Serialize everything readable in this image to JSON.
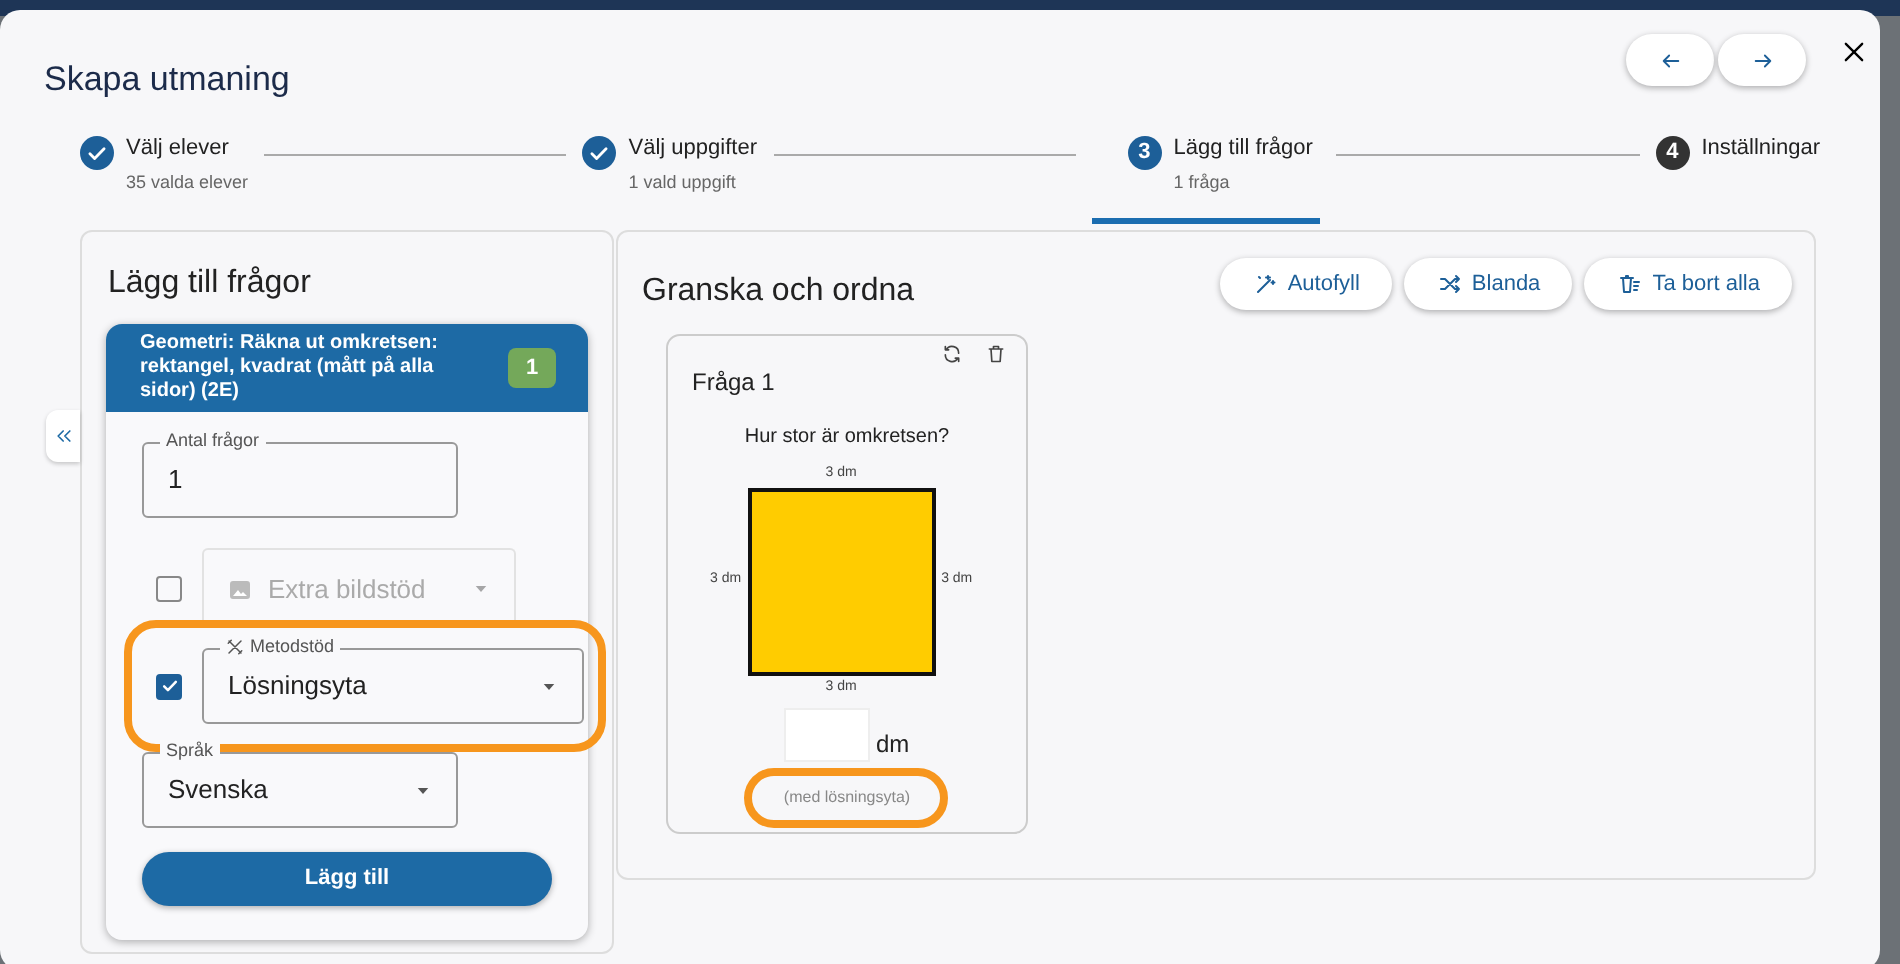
{
  "dialog": {
    "title": "Skapa utmaning"
  },
  "steps": [
    {
      "label": "Välj elever",
      "sublabel": "35 valda elever",
      "completed": true,
      "selected": false
    },
    {
      "label": "Välj uppgifter",
      "sublabel": "1 vald uppgift",
      "completed": true,
      "selected": false
    },
    {
      "label": "Lägg till frågor",
      "sublabel": "1 fråga",
      "number": "3",
      "completed": false,
      "selected": true
    },
    {
      "label": "Inställningar",
      "number": "4",
      "completed": false,
      "selected": false
    }
  ],
  "add_panel": {
    "title": "Lägg till frågor",
    "task": {
      "title": "Geometri: Räkna ut omkretsen: rektangel, kvadrat (mått på alla sidor) (2E)",
      "count": "1"
    },
    "count_field": {
      "label": "Antal frågor",
      "value": "1"
    },
    "options": [
      {
        "kind": "image-support",
        "value": "Extra bildstöd",
        "checked": false,
        "disabled": true,
        "highlighted": false
      },
      {
        "kind": "method-support",
        "label": "Metodstöd",
        "value": "Lösningsyta",
        "checked": true,
        "disabled": false,
        "highlighted": true
      }
    ],
    "language": {
      "label": "Språk",
      "value": "Svenska"
    },
    "add_button": "Lägg till"
  },
  "review_panel": {
    "title": "Granska och ordna",
    "actions": [
      {
        "kind": "autofill",
        "label": "Autofyll"
      },
      {
        "kind": "shuffle",
        "label": "Blanda"
      },
      {
        "kind": "delete-all",
        "label": "Ta bort alla"
      }
    ],
    "questions": [
      {
        "title": "Fråga 1",
        "prompt": "Hur stor är omkretsen?",
        "side_top": "3 dm",
        "side_left": "3 dm",
        "side_right": "3 dm",
        "side_bottom": "3 dm",
        "color": "#ffcc00",
        "unit": "dm",
        "note": "(med lösningsyta)",
        "note_highlighted": true
      }
    ]
  }
}
